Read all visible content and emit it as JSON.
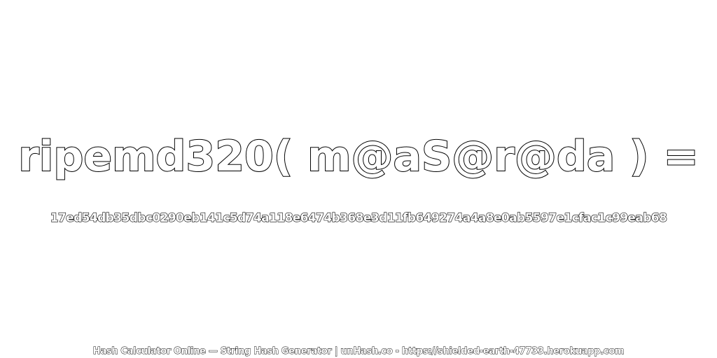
{
  "headline": "ripemd320( m@aS@r@da ) =",
  "hash_value": "17ed54db35dbc0290eb141c5d74a118e6474b368e3d11fb649274a4a8e0ab5597e1cfac1c99eab68",
  "footer": "Hash Calculator Online — String Hash Generator | unHash.co - https://shielded-earth-47733.herokuapp.com",
  "colors": {
    "background": "#ffffff",
    "text_fill": "#ffffff",
    "text_outline": "#000000"
  }
}
